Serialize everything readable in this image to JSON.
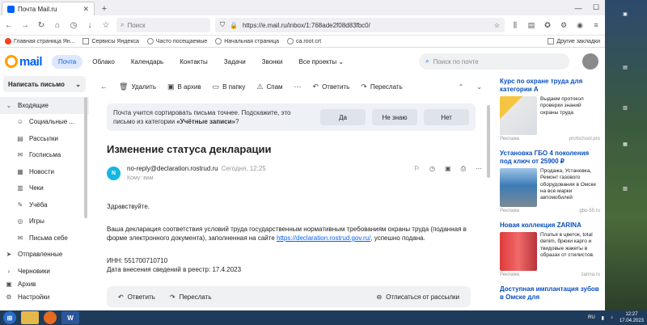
{
  "browser": {
    "tab_title": "Почта Mail.ru",
    "search_placeholder": "Поиск",
    "url": "https://e.mail.ru/inbox/1:768ade2f08d83fbc0/",
    "bookmarks": [
      "Главная страница Ян...",
      "Сервисы Яндекса",
      "Часто посещаемые",
      "Начальная страница",
      "ca.root.crt"
    ],
    "bookmarks_right": "Другие закладки"
  },
  "mail_header": {
    "logo": "mail",
    "tabs": [
      "Почта",
      "Облако",
      "Календарь",
      "Контакты",
      "Задачи",
      "Звонки",
      "Все проекты"
    ],
    "search_placeholder": "Поиск по почте"
  },
  "sidebar": {
    "compose": "Написать письмо",
    "folders": [
      {
        "label": "Входящие",
        "icon": "inbox-icon"
      },
      {
        "label": "Социальные ...",
        "icon": "social-icon"
      },
      {
        "label": "Рассылки",
        "icon": "newsletters-icon"
      },
      {
        "label": "Госписьма",
        "icon": "gov-mail-icon"
      },
      {
        "label": "Новости",
        "icon": "news-icon"
      },
      {
        "label": "Чеки",
        "icon": "receipts-icon"
      },
      {
        "label": "Учёба",
        "icon": "study-icon"
      },
      {
        "label": "Игры",
        "icon": "games-icon"
      },
      {
        "label": "Письма себе",
        "icon": "self-mail-icon"
      },
      {
        "label": "Отправленные",
        "icon": "sent-icon"
      },
      {
        "label": "Черновики",
        "icon": "drafts-icon"
      },
      {
        "label": "Архив",
        "icon": "archive-icon"
      }
    ],
    "settings": "Настройки"
  },
  "toolbar": {
    "delete": "Удалить",
    "archive": "В архив",
    "to_folder": "В папку",
    "spam": "Спам",
    "reply": "Ответить",
    "forward": "Переслать"
  },
  "banner": {
    "text_before": "Почта учится сортировать письма точнее. Подскажите, это письмо из категории ",
    "category": "«Учётные записи»",
    "text_after": "?",
    "yes": "Да",
    "dont_know": "Не знаю",
    "no": "Нет"
  },
  "email": {
    "subject": "Изменение статуса декларации",
    "avatar_letter": "N",
    "from": "no-reply@declaration.rostrud.ru",
    "date": "Сегодня, 12:25",
    "to": "Кому: вам",
    "greeting": "Здравствуйте.",
    "para_before_link": "Ваша декларация соответствия условий труда государственным нормативным требованиям охраны труда (поданная в форме электронного документа), заполненная на сайте ",
    "link": "https://declaration.rostrud.gov.ru/",
    "para_after_link": ", успешно подана.",
    "inn": "ИНН: 551700710710",
    "reg_date": "Дата внесения сведений в реестр: 17.4.2023"
  },
  "replybar": {
    "reply": "Ответить",
    "forward": "Переслать",
    "unsubscribe": "Отписаться от рассылки"
  },
  "ads": [
    {
      "title": "Курс по охране труда для категории А",
      "desc": "Выдаем протокол проверки знаний охраны труда",
      "label": "Реклама",
      "domain": "profschool.pro"
    },
    {
      "title": "Установка ГБО 4 поколения под ключ от 25900 ₽",
      "desc": "Продажа, Установка, Ремонт газового оборудования в Омске на все марки автомобилей",
      "label": "Реклама",
      "domain": "gbo-55.ru"
    },
    {
      "title": "Новая коллекция ZARINA",
      "desc": "Платья в цветок, total denim, брюки карго и твидовые жакеты в образах от стилистов.",
      "label": "Реклама",
      "domain": "zarina.ru"
    },
    {
      "title": "Доступная имплантация зубов в Омске для",
      "desc": "",
      "label": "",
      "domain": ""
    }
  ],
  "taskbar": {
    "lang": "RU",
    "time": "12:27",
    "date": "17.04.2023"
  }
}
